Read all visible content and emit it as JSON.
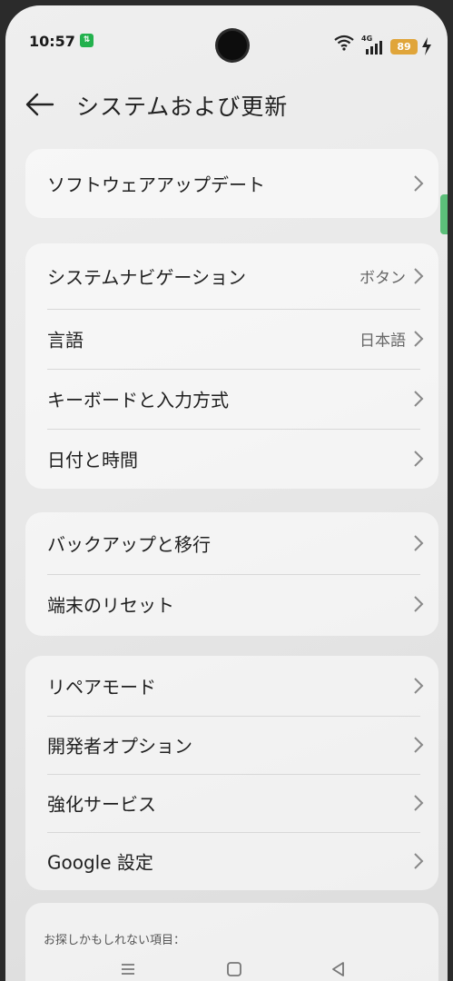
{
  "status_bar": {
    "time": "10:57",
    "notif_label": "⇅",
    "network": "4G",
    "battery": "89"
  },
  "header": {
    "title": "システムおよび更新"
  },
  "sections": [
    {
      "items": [
        {
          "label": "ソフトウェアアップデート"
        }
      ]
    },
    {
      "items": [
        {
          "label": "システムナビゲーション",
          "value": "ボタン"
        },
        {
          "label": "言語",
          "value": "日本語"
        },
        {
          "label": "キーボードと入力方式"
        },
        {
          "label": "日付と時間"
        }
      ]
    },
    {
      "items": [
        {
          "label": "バックアップと移行"
        },
        {
          "label": "端末のリセット"
        }
      ]
    },
    {
      "items": [
        {
          "label": "リペアモード"
        },
        {
          "label": "開発者オプション"
        },
        {
          "label": "強化サービス"
        },
        {
          "label": "Google 設定"
        }
      ]
    }
  ],
  "suggestions": {
    "label": "お探しかもしれない項目："
  },
  "navbar": {
    "items": [
      "menu-icon",
      "home-icon",
      "back-icon"
    ]
  }
}
